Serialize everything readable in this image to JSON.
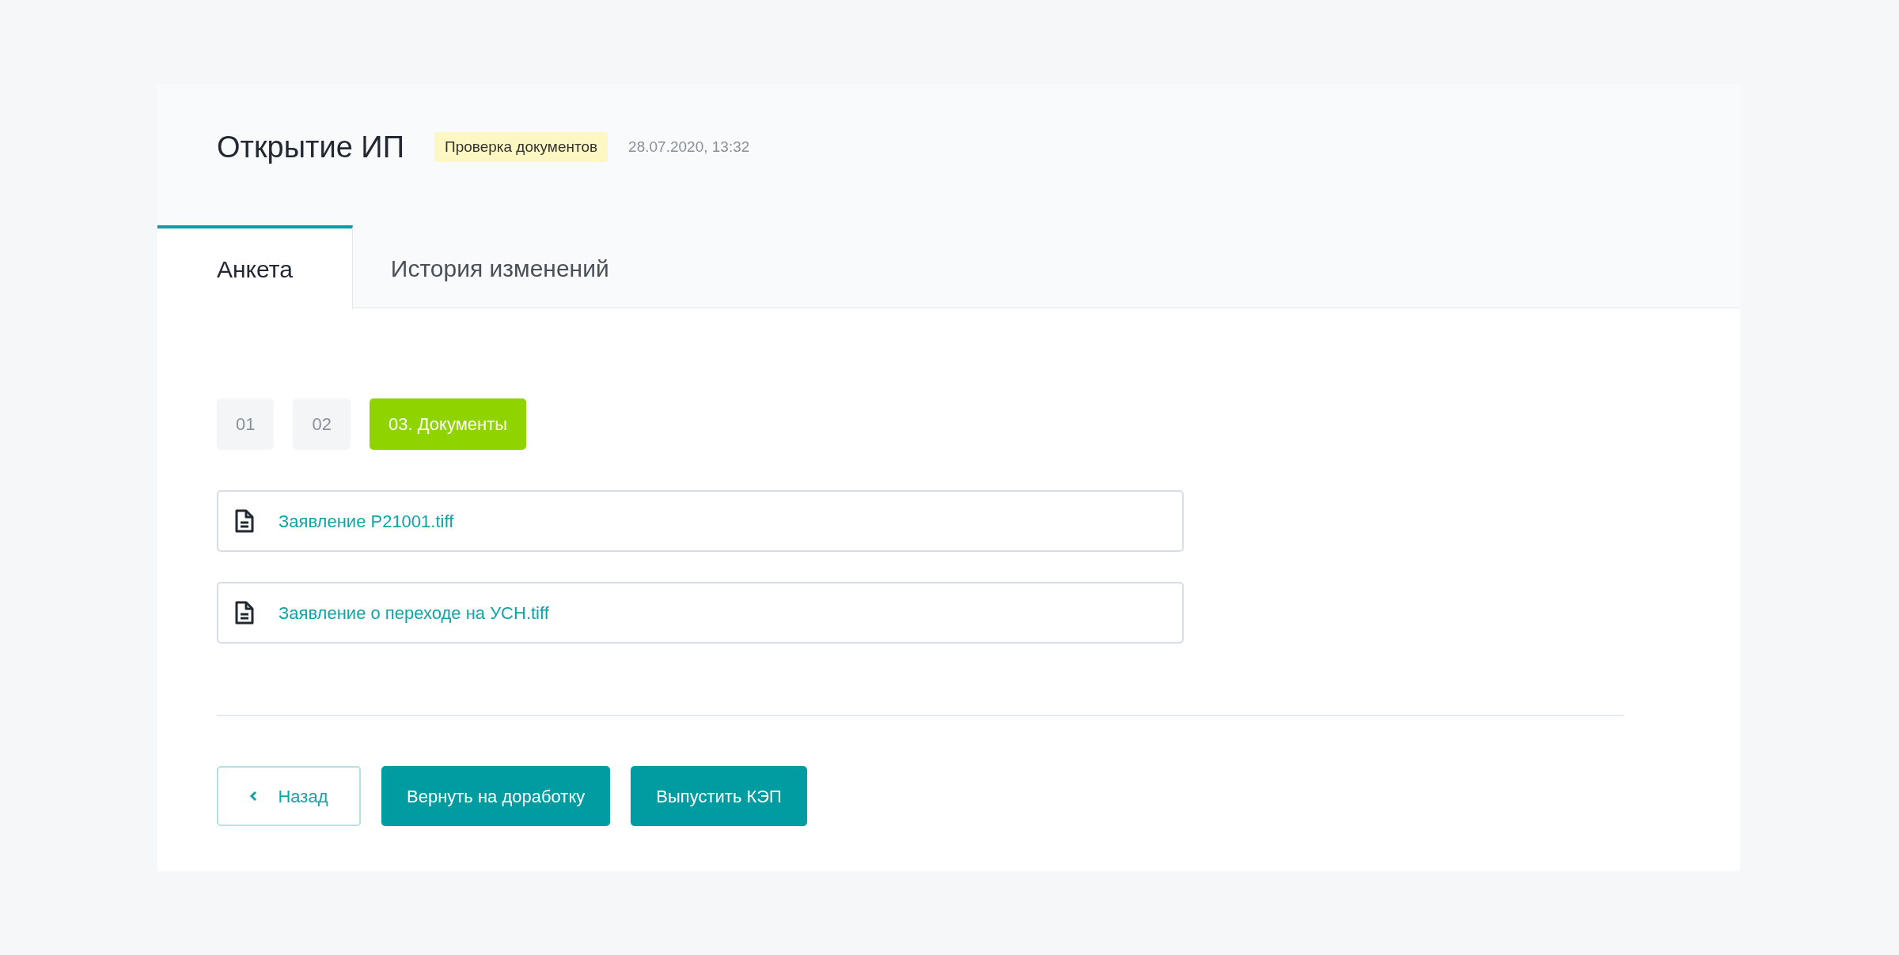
{
  "header": {
    "title": "Открытие ИП",
    "status_badge": "Проверка документов",
    "timestamp": "28.07.2020, 13:32"
  },
  "tabs": [
    {
      "label": "Анкета",
      "selected": true
    },
    {
      "label": "История изменений",
      "selected": false
    }
  ],
  "steps": [
    {
      "label": "01",
      "selected": false
    },
    {
      "label": "02",
      "selected": false
    },
    {
      "label": "03. Документы",
      "selected": true
    }
  ],
  "files": [
    {
      "name": "Заявление Р21001.tiff"
    },
    {
      "name": "Заявление о переходе на УСН.tiff"
    }
  ],
  "buttons": [
    {
      "label": "Назад",
      "kind": "back"
    },
    {
      "label": "Вернуть на доработку",
      "kind": "primary"
    },
    {
      "label": "Выпустить КЭП",
      "kind": "primary"
    }
  ]
}
